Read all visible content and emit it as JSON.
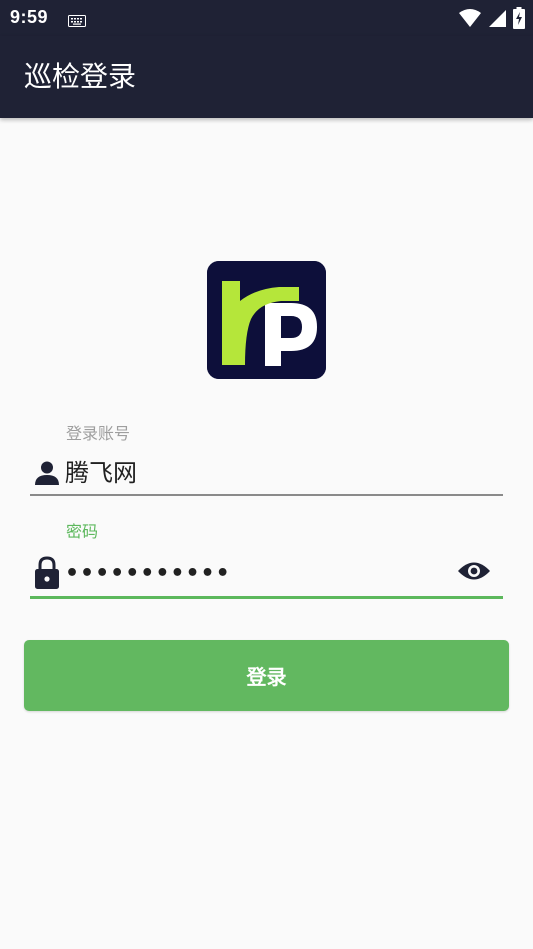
{
  "status_bar": {
    "time": "9:59",
    "icons": [
      "keyboard-icon",
      "wifi-icon",
      "cell-signal-icon",
      "battery-charging-icon"
    ]
  },
  "app_bar": {
    "title": "巡检登录"
  },
  "logo": {
    "icon": "app-logo",
    "colors": {
      "background": "#0d0f3a",
      "accent": "#b5e63a",
      "white": "#ffffff"
    }
  },
  "form": {
    "account": {
      "label": "登录账号",
      "value": "腾飞网",
      "icon": "person-icon"
    },
    "password": {
      "label": "密码",
      "value": "•••••••••••",
      "icon": "lock-icon",
      "toggle_icon": "eye-icon"
    },
    "submit_label": "登录"
  },
  "colors": {
    "header": "#1f2235",
    "accent_green": "#62b860",
    "background": "#fafafa"
  }
}
